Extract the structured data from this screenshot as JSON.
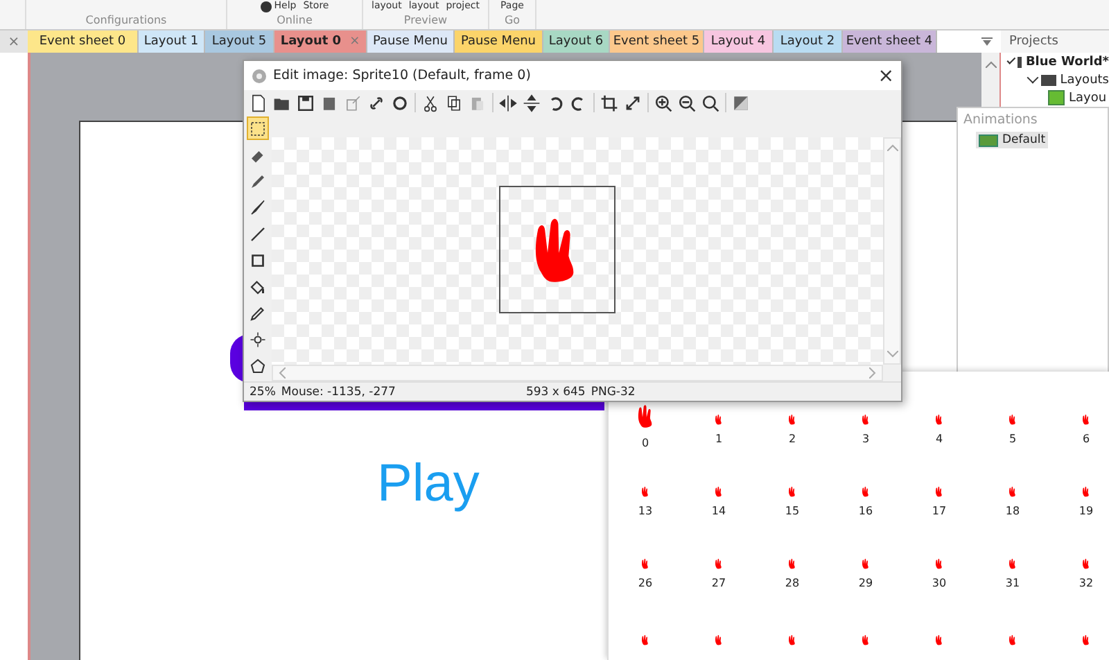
{
  "ribbon": {
    "groups": [
      {
        "label": "Configurations"
      },
      {
        "label": "Online",
        "buttons": [
          {
            "label": "Help",
            "kind": "help"
          },
          {
            "label": "Store",
            "kind": "plain"
          }
        ]
      },
      {
        "label": "Preview",
        "buttons": [
          {
            "label": "layout",
            "kind": "plain"
          },
          {
            "label": "layout",
            "kind": "plain"
          },
          {
            "label": "project",
            "kind": "plain"
          }
        ]
      },
      {
        "label": "Go",
        "buttons": [
          {
            "label": "Page",
            "kind": "plain"
          }
        ]
      }
    ]
  },
  "left_panel": {
    "close": "×"
  },
  "tabs": [
    {
      "label": "Event sheet 0",
      "color": "#fde68a",
      "selected": false
    },
    {
      "label": "Layout 1",
      "color": "#cfe6f7",
      "selected": false
    },
    {
      "label": "Layout 5",
      "color": "#a9c8e0",
      "selected": false
    },
    {
      "label": "Layout 0",
      "color": "#e8908c",
      "selected": true,
      "close": "×"
    },
    {
      "label": "Pause Menu",
      "color": "#dde8f7",
      "selected": false
    },
    {
      "label": "Pause Menu",
      "color": "#fbd46a",
      "selected": false
    },
    {
      "label": "Layout 6",
      "color": "#a8d8c4",
      "selected": false
    },
    {
      "label": "Event sheet 5",
      "color": "#fcc88c",
      "selected": false
    },
    {
      "label": "Layout 4",
      "color": "#f7c6e0",
      "selected": false
    },
    {
      "label": "Layout 2",
      "color": "#b9dcf2",
      "selected": false
    },
    {
      "label": "Event sheet 4",
      "color": "#c9b6d9",
      "selected": false
    }
  ],
  "projects": {
    "title": "Projects",
    "tree": [
      {
        "label": "Blue World*",
        "expanded": true,
        "children": [
          {
            "label": "Layouts",
            "expanded": true,
            "children": [
              {
                "label": "Layou"
              }
            ]
          }
        ]
      }
    ]
  },
  "layout_view": {
    "play_text": "Play"
  },
  "image_editor": {
    "title": "Edit image: Sprite10 (Default, frame 0)",
    "close": "×",
    "tools": [
      {
        "kind": "select",
        "selected": true
      },
      {
        "kind": "eraser",
        "selected": false
      },
      {
        "kind": "pencil",
        "selected": false
      },
      {
        "kind": "brush",
        "selected": false
      },
      {
        "kind": "line",
        "selected": false
      },
      {
        "kind": "rectangle",
        "selected": false
      },
      {
        "kind": "fill",
        "selected": false
      },
      {
        "kind": "picker",
        "selected": false
      },
      {
        "kind": "origin",
        "selected": false
      },
      {
        "kind": "polygon",
        "selected": false
      }
    ],
    "status": {
      "zoom": "25%",
      "mouse": "Mouse: -1135, -277",
      "size": "593 x 645",
      "format": "PNG-32"
    }
  },
  "animations": {
    "title": "Animations",
    "items": [
      {
        "label": "Default",
        "selected": true
      }
    ]
  },
  "frames": [
    {
      "label": "0",
      "large": true
    },
    {
      "label": "1",
      "large": false
    },
    {
      "label": "2",
      "large": false
    },
    {
      "label": "3",
      "large": false
    },
    {
      "label": "4",
      "large": false
    },
    {
      "label": "5",
      "large": false
    },
    {
      "label": "6",
      "large": false
    },
    {
      "label": "13",
      "large": false
    },
    {
      "label": "14",
      "large": false
    },
    {
      "label": "15",
      "large": false
    },
    {
      "label": "16",
      "large": false
    },
    {
      "label": "17",
      "large": false
    },
    {
      "label": "18",
      "large": false
    },
    {
      "label": "19",
      "large": false
    },
    {
      "label": "26",
      "large": false
    },
    {
      "label": "27",
      "large": false
    },
    {
      "label": "28",
      "large": false
    },
    {
      "label": "29",
      "large": false
    },
    {
      "label": "30",
      "large": false
    },
    {
      "label": "31",
      "large": false
    },
    {
      "label": "32",
      "large": false
    },
    {
      "large": false
    },
    {
      "large": false
    },
    {
      "large": false
    },
    {
      "large": false
    },
    {
      "large": false
    },
    {
      "large": false
    },
    {
      "large": false
    }
  ]
}
